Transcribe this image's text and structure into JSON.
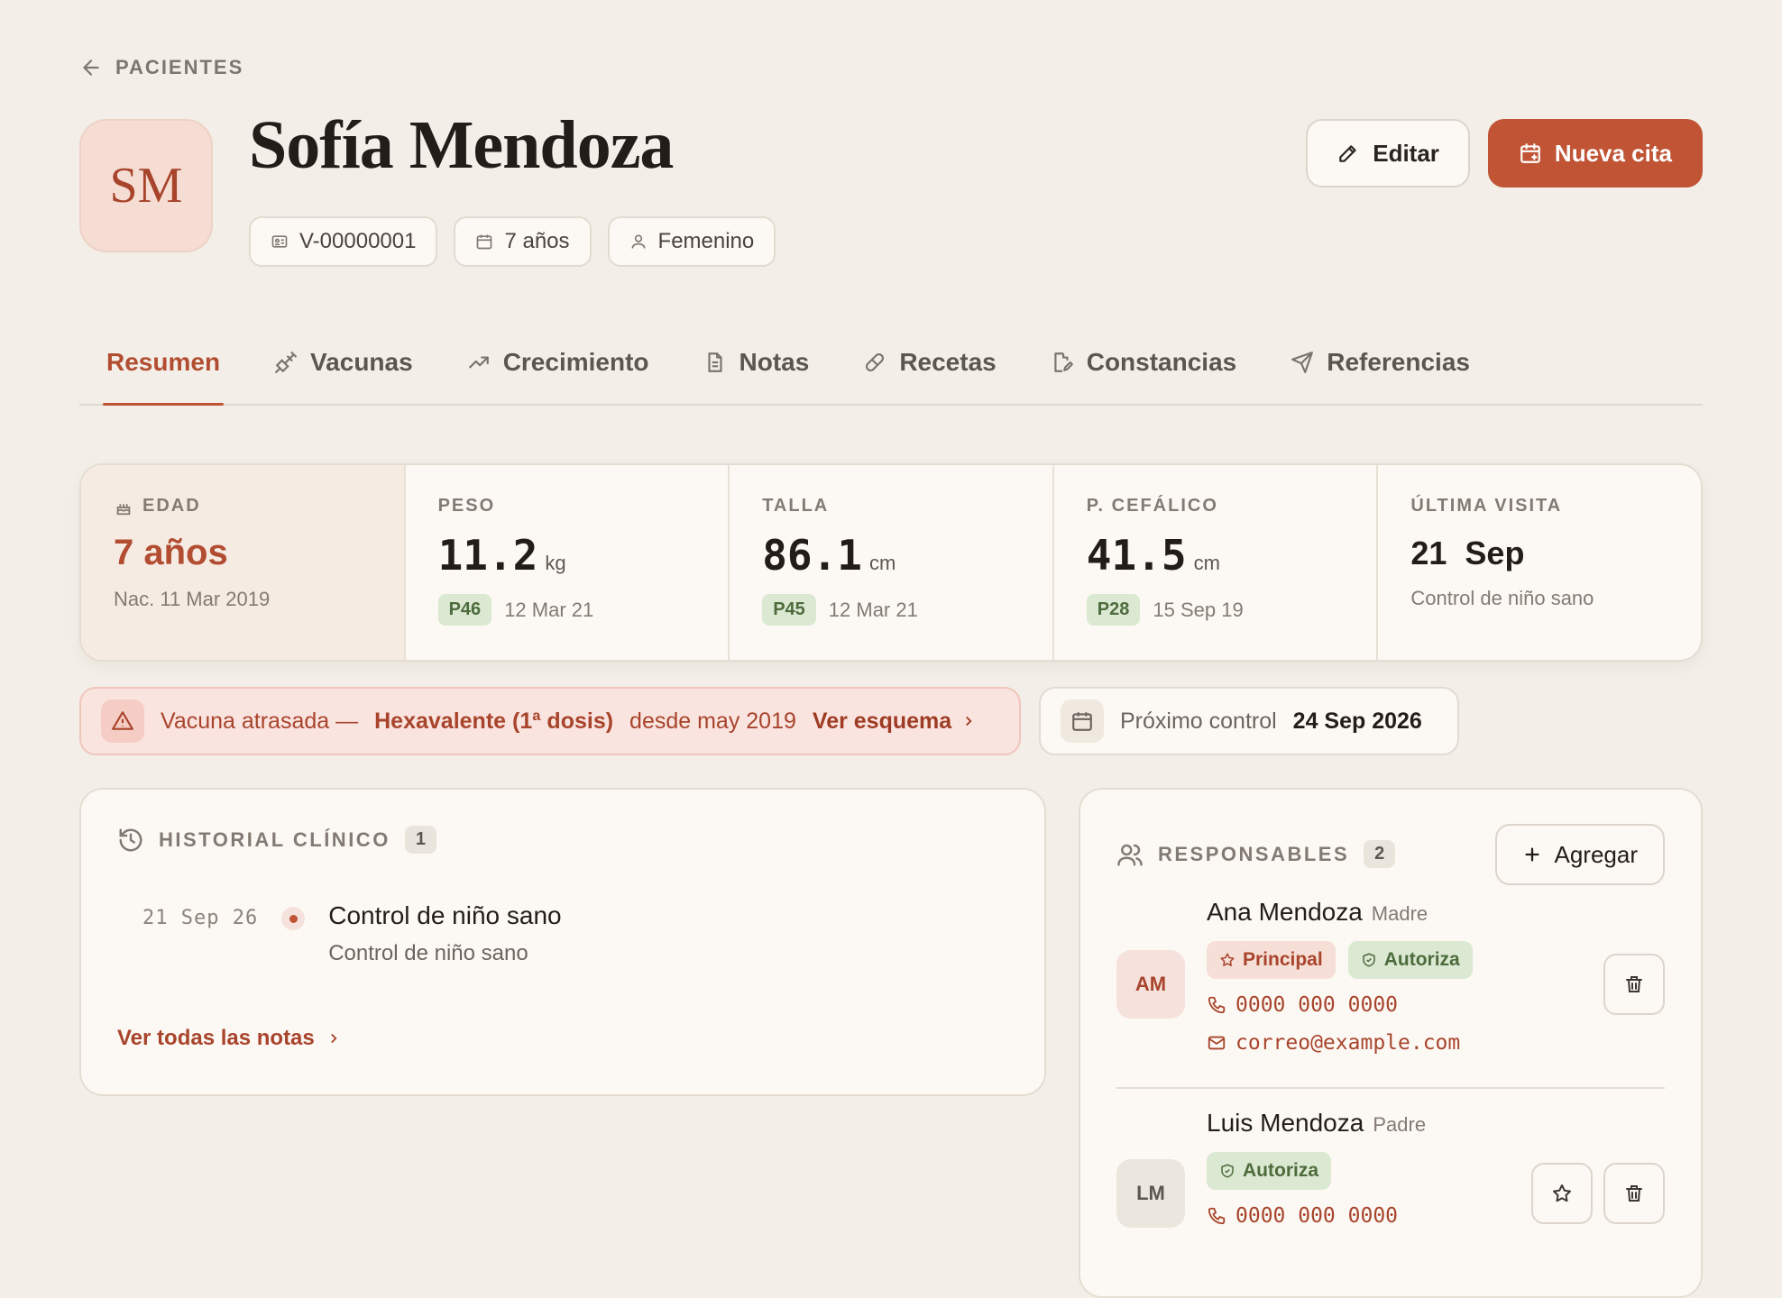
{
  "nav": {
    "back_label": "PACIENTES"
  },
  "patient": {
    "initials": "SM",
    "name": "Sofía Mendoza",
    "id_number": "V-00000001",
    "age": "7 años",
    "sex": "Femenino"
  },
  "actions": {
    "edit_label": "Editar",
    "new_appointment_label": "Nueva cita"
  },
  "tabs": [
    {
      "label": "Resumen",
      "icon": "home",
      "active": true
    },
    {
      "label": "Vacunas",
      "icon": "syringe-icon"
    },
    {
      "label": "Crecimiento",
      "icon": "trending-up-icon"
    },
    {
      "label": "Notas",
      "icon": "file-text-icon"
    },
    {
      "label": "Recetas",
      "icon": "pill-icon"
    },
    {
      "label": "Constancias",
      "icon": "file-edit-icon"
    },
    {
      "label": "Referencias",
      "icon": "send-icon"
    }
  ],
  "stats": {
    "age": {
      "label": "EDAD",
      "value": "7 años",
      "sub": "Nac. 11 Mar 2019"
    },
    "weight": {
      "label": "PESO",
      "value": "11.2",
      "unit": "kg",
      "percentile": "P46",
      "date": "12 Mar 21"
    },
    "height": {
      "label": "TALLA",
      "value": "86.1",
      "unit": "cm",
      "percentile": "P45",
      "date": "12 Mar 21"
    },
    "head": {
      "label": "P. CEFÁLICO",
      "value": "41.5",
      "unit": "cm",
      "percentile": "P28",
      "date": "15 Sep 19"
    },
    "last_visit": {
      "label": "ÚLTIMA VISITA",
      "value": "21  Sep",
      "sub": "Control de niño sano"
    }
  },
  "alert": {
    "prefix": "Vacuna atrasada —",
    "vaccine": "Hexavalente (1ª dosis)",
    "since": "desde may 2019",
    "link": "Ver esquema"
  },
  "next_control": {
    "label": "Próximo control",
    "date": "24 Sep 2026"
  },
  "history": {
    "title": "HISTORIAL CLÍNICO",
    "count": "1",
    "entries": [
      {
        "date": "21 Sep 26",
        "title": "Control de niño sano",
        "subtitle": "Control de niño sano"
      }
    ],
    "link": "Ver todas las notas"
  },
  "guardians": {
    "title": "RESPONSABLES",
    "count": "2",
    "add_label": "Agregar",
    "people": [
      {
        "initials": "AM",
        "name": "Ana Mendoza",
        "role": "Madre",
        "tags": [
          "Principal",
          "Autoriza"
        ],
        "phone": "0000 000 0000",
        "email": "correo@example.com"
      },
      {
        "initials": "LM",
        "name": "Luis Mendoza",
        "role": "Padre",
        "tags": [
          "Autoriza"
        ],
        "phone": "0000 000 0000"
      }
    ]
  },
  "colors": {
    "accent": "#c05435",
    "background": "#f3efe8",
    "card": "#fcf9f4",
    "success_bg": "#dbe8d2",
    "danger_bg": "#fae4df"
  }
}
